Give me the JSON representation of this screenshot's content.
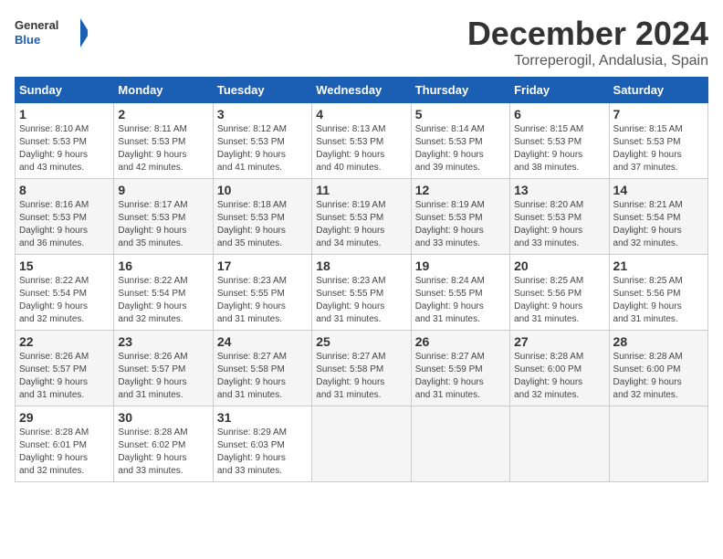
{
  "logo": {
    "line1": "General",
    "line2": "Blue"
  },
  "title": "December 2024",
  "subtitle": "Torreperogil, Andalusia, Spain",
  "days_of_week": [
    "Sunday",
    "Monday",
    "Tuesday",
    "Wednesday",
    "Thursday",
    "Friday",
    "Saturday"
  ],
  "weeks": [
    [
      {
        "day": "1",
        "info": "Sunrise: 8:10 AM\nSunset: 5:53 PM\nDaylight: 9 hours\nand 43 minutes."
      },
      {
        "day": "2",
        "info": "Sunrise: 8:11 AM\nSunset: 5:53 PM\nDaylight: 9 hours\nand 42 minutes."
      },
      {
        "day": "3",
        "info": "Sunrise: 8:12 AM\nSunset: 5:53 PM\nDaylight: 9 hours\nand 41 minutes."
      },
      {
        "day": "4",
        "info": "Sunrise: 8:13 AM\nSunset: 5:53 PM\nDaylight: 9 hours\nand 40 minutes."
      },
      {
        "day": "5",
        "info": "Sunrise: 8:14 AM\nSunset: 5:53 PM\nDaylight: 9 hours\nand 39 minutes."
      },
      {
        "day": "6",
        "info": "Sunrise: 8:15 AM\nSunset: 5:53 PM\nDaylight: 9 hours\nand 38 minutes."
      },
      {
        "day": "7",
        "info": "Sunrise: 8:15 AM\nSunset: 5:53 PM\nDaylight: 9 hours\nand 37 minutes."
      }
    ],
    [
      {
        "day": "8",
        "info": "Sunrise: 8:16 AM\nSunset: 5:53 PM\nDaylight: 9 hours\nand 36 minutes."
      },
      {
        "day": "9",
        "info": "Sunrise: 8:17 AM\nSunset: 5:53 PM\nDaylight: 9 hours\nand 35 minutes."
      },
      {
        "day": "10",
        "info": "Sunrise: 8:18 AM\nSunset: 5:53 PM\nDaylight: 9 hours\nand 35 minutes."
      },
      {
        "day": "11",
        "info": "Sunrise: 8:19 AM\nSunset: 5:53 PM\nDaylight: 9 hours\nand 34 minutes."
      },
      {
        "day": "12",
        "info": "Sunrise: 8:19 AM\nSunset: 5:53 PM\nDaylight: 9 hours\nand 33 minutes."
      },
      {
        "day": "13",
        "info": "Sunrise: 8:20 AM\nSunset: 5:53 PM\nDaylight: 9 hours\nand 33 minutes."
      },
      {
        "day": "14",
        "info": "Sunrise: 8:21 AM\nSunset: 5:54 PM\nDaylight: 9 hours\nand 32 minutes."
      }
    ],
    [
      {
        "day": "15",
        "info": "Sunrise: 8:22 AM\nSunset: 5:54 PM\nDaylight: 9 hours\nand 32 minutes."
      },
      {
        "day": "16",
        "info": "Sunrise: 8:22 AM\nSunset: 5:54 PM\nDaylight: 9 hours\nand 32 minutes."
      },
      {
        "day": "17",
        "info": "Sunrise: 8:23 AM\nSunset: 5:55 PM\nDaylight: 9 hours\nand 31 minutes."
      },
      {
        "day": "18",
        "info": "Sunrise: 8:23 AM\nSunset: 5:55 PM\nDaylight: 9 hours\nand 31 minutes."
      },
      {
        "day": "19",
        "info": "Sunrise: 8:24 AM\nSunset: 5:55 PM\nDaylight: 9 hours\nand 31 minutes."
      },
      {
        "day": "20",
        "info": "Sunrise: 8:25 AM\nSunset: 5:56 PM\nDaylight: 9 hours\nand 31 minutes."
      },
      {
        "day": "21",
        "info": "Sunrise: 8:25 AM\nSunset: 5:56 PM\nDaylight: 9 hours\nand 31 minutes."
      }
    ],
    [
      {
        "day": "22",
        "info": "Sunrise: 8:26 AM\nSunset: 5:57 PM\nDaylight: 9 hours\nand 31 minutes."
      },
      {
        "day": "23",
        "info": "Sunrise: 8:26 AM\nSunset: 5:57 PM\nDaylight: 9 hours\nand 31 minutes."
      },
      {
        "day": "24",
        "info": "Sunrise: 8:27 AM\nSunset: 5:58 PM\nDaylight: 9 hours\nand 31 minutes."
      },
      {
        "day": "25",
        "info": "Sunrise: 8:27 AM\nSunset: 5:58 PM\nDaylight: 9 hours\nand 31 minutes."
      },
      {
        "day": "26",
        "info": "Sunrise: 8:27 AM\nSunset: 5:59 PM\nDaylight: 9 hours\nand 31 minutes."
      },
      {
        "day": "27",
        "info": "Sunrise: 8:28 AM\nSunset: 6:00 PM\nDaylight: 9 hours\nand 32 minutes."
      },
      {
        "day": "28",
        "info": "Sunrise: 8:28 AM\nSunset: 6:00 PM\nDaylight: 9 hours\nand 32 minutes."
      }
    ],
    [
      {
        "day": "29",
        "info": "Sunrise: 8:28 AM\nSunset: 6:01 PM\nDaylight: 9 hours\nand 32 minutes."
      },
      {
        "day": "30",
        "info": "Sunrise: 8:28 AM\nSunset: 6:02 PM\nDaylight: 9 hours\nand 33 minutes."
      },
      {
        "day": "31",
        "info": "Sunrise: 8:29 AM\nSunset: 6:03 PM\nDaylight: 9 hours\nand 33 minutes."
      },
      {
        "day": "",
        "info": ""
      },
      {
        "day": "",
        "info": ""
      },
      {
        "day": "",
        "info": ""
      },
      {
        "day": "",
        "info": ""
      }
    ]
  ]
}
